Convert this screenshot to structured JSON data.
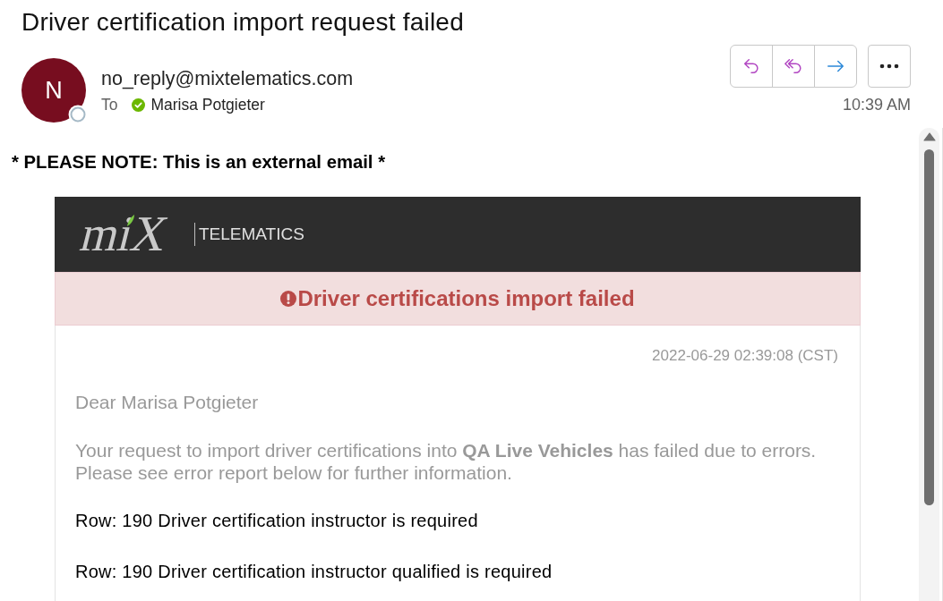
{
  "message": {
    "subject": "Driver certification import request failed",
    "sender": {
      "initial": "N",
      "address": "no_reply@mixtelematics.com"
    },
    "to_label": "To",
    "recipients": [
      {
        "name": "Marisa Potgieter"
      }
    ],
    "time": "10:39 AM"
  },
  "external_note": "* PLEASE NOTE: This is an external email *",
  "email": {
    "logo": {
      "mark": "miX",
      "wordmark": "TELEMATICS"
    },
    "alert": "Driver certifications import failed",
    "timestamp": "2022-06-29 02:39:08 (CST)",
    "greeting": "Dear Marisa Potgieter",
    "intro": "Your request to import driver certifications into **QA Live Vehicles** has failed due to errors. Please see error report below for further information.",
    "errors": [
      "Row: 190 Driver certification instructor is required",
      "Row: 190 Driver certification instructor qualified is required"
    ]
  }
}
